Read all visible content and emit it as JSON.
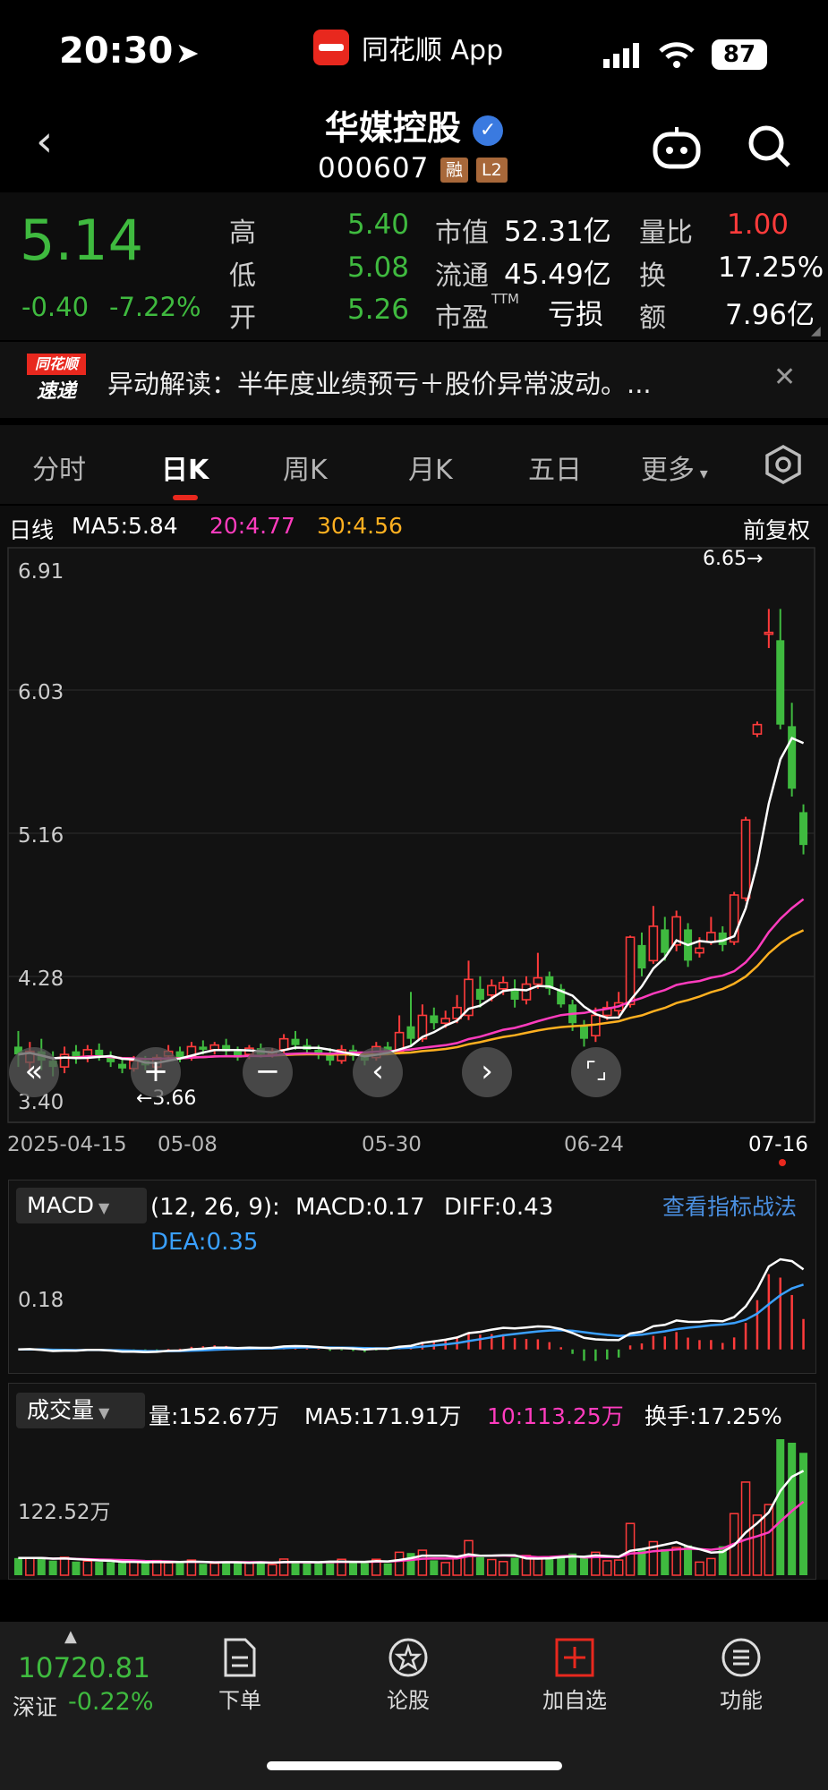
{
  "status_bar": {
    "time": "20:30",
    "app_name": "同花顺 App",
    "battery": "87"
  },
  "header": {
    "name": "华媒控股",
    "code": "000607",
    "tag_margin": "融",
    "tag_level": "L2"
  },
  "quote": {
    "price": "5.14",
    "change": "-0.40",
    "change_pct": "-7.22%",
    "high_label": "高",
    "high": "5.40",
    "low_label": "低",
    "low": "5.08",
    "open_label": "开",
    "open": "5.26",
    "mktcap_label": "市值",
    "mktcap": "52.31亿",
    "float_label": "流通",
    "float_cap": "45.49亿",
    "pe_label": "市盈",
    "pe_sup": "TTM",
    "pe": "亏损",
    "vol_ratio_label": "量比",
    "vol_ratio": "1.00",
    "turnover_label": "换",
    "turnover": "17.25%",
    "amount_label": "额",
    "amount": "7.96亿"
  },
  "news": {
    "badge_top": "同花顺",
    "badge_bottom": "速递",
    "text": "异动解读：半年度业绩预亏＋股价异常波动。..."
  },
  "tabs": [
    "分时",
    "日K",
    "周K",
    "月K",
    "五日",
    "更多"
  ],
  "active_tab": "日K",
  "kline": {
    "period_label": "日线",
    "ma5": "MA5:5.84",
    "ma20": "20:4.77",
    "ma30": "30:4.56",
    "adjust": "前复权",
    "y_labels": [
      "6.91",
      "6.03",
      "5.16",
      "4.28",
      "3.40"
    ],
    "high_mark": "6.65→",
    "low_mark": "←3.66",
    "dates": [
      "2025-04-15",
      "05-08",
      "05-30",
      "06-24",
      "07-16"
    ]
  },
  "macd": {
    "name": "MACD",
    "params": "(12, 26, 9):",
    "macd": "MACD:0.17",
    "diff": "DIFF:0.43",
    "dea": "DEA:0.35",
    "link": "查看指标战法",
    "y_label": "0.18"
  },
  "volume": {
    "name": "成交量",
    "vol": "量:152.67万",
    "ma5": "MA5:171.91万",
    "ma10": "10:113.25万",
    "turnover": "换手:17.25%",
    "y_label": "122.52万"
  },
  "index": {
    "value": "10720.81",
    "name": "深证",
    "change": "-0.22%"
  },
  "bottom_nav": [
    "下单",
    "论股",
    "加自选",
    "功能"
  ],
  "colors": {
    "up": "#ff3b3b",
    "down": "#3fba3f",
    "ma5": "#ffffff",
    "ma20": "#ff3cbe",
    "ma30": "#ffb020",
    "dea": "#3aa0ff",
    "link": "#4a8fe0"
  },
  "chart_data": {
    "type": "candlestick",
    "y_range": [
      3.4,
      6.91
    ],
    "candles": [
      {
        "o": 3.85,
        "c": 3.8,
        "h": 3.95,
        "l": 3.72
      },
      {
        "o": 3.75,
        "c": 3.82,
        "h": 3.88,
        "l": 3.7
      },
      {
        "o": 3.82,
        "c": 3.76,
        "h": 3.9,
        "l": 3.7
      },
      {
        "o": 3.76,
        "c": 3.72,
        "h": 3.82,
        "l": 3.66
      },
      {
        "o": 3.72,
        "c": 3.8,
        "h": 3.85,
        "l": 3.68
      },
      {
        "o": 3.82,
        "c": 3.78,
        "h": 3.86,
        "l": 3.74
      },
      {
        "o": 3.78,
        "c": 3.83,
        "h": 3.86,
        "l": 3.75
      },
      {
        "o": 3.83,
        "c": 3.79,
        "h": 3.87,
        "l": 3.76
      },
      {
        "o": 3.79,
        "c": 3.75,
        "h": 3.82,
        "l": 3.72
      },
      {
        "o": 3.74,
        "c": 3.71,
        "h": 3.78,
        "l": 3.68
      },
      {
        "o": 3.71,
        "c": 3.76,
        "h": 3.79,
        "l": 3.69
      },
      {
        "o": 3.76,
        "c": 3.73,
        "h": 3.79,
        "l": 3.7
      },
      {
        "o": 3.72,
        "c": 3.78,
        "h": 3.8,
        "l": 3.7
      },
      {
        "o": 3.79,
        "c": 3.82,
        "h": 3.86,
        "l": 3.76
      },
      {
        "o": 3.82,
        "c": 3.78,
        "h": 3.85,
        "l": 3.75
      },
      {
        "o": 3.79,
        "c": 3.85,
        "h": 3.88,
        "l": 3.76
      },
      {
        "o": 3.85,
        "c": 3.83,
        "h": 3.89,
        "l": 3.8
      },
      {
        "o": 3.83,
        "c": 3.86,
        "h": 3.88,
        "l": 3.8
      },
      {
        "o": 3.86,
        "c": 3.82,
        "h": 3.9,
        "l": 3.79
      },
      {
        "o": 3.82,
        "c": 3.78,
        "h": 3.85,
        "l": 3.76
      },
      {
        "o": 3.8,
        "c": 3.84,
        "h": 3.86,
        "l": 3.77
      },
      {
        "o": 3.84,
        "c": 3.8,
        "h": 3.87,
        "l": 3.78
      },
      {
        "o": 3.8,
        "c": 3.82,
        "h": 3.84,
        "l": 3.78
      },
      {
        "o": 3.83,
        "c": 3.9,
        "h": 3.93,
        "l": 3.8
      },
      {
        "o": 3.9,
        "c": 3.86,
        "h": 3.95,
        "l": 3.83
      },
      {
        "o": 3.86,
        "c": 3.83,
        "h": 3.9,
        "l": 3.8
      },
      {
        "o": 3.83,
        "c": 3.8,
        "h": 3.86,
        "l": 3.77
      },
      {
        "o": 3.8,
        "c": 3.76,
        "h": 3.84,
        "l": 3.73
      },
      {
        "o": 3.76,
        "c": 3.83,
        "h": 3.86,
        "l": 3.74
      },
      {
        "o": 3.83,
        "c": 3.79,
        "h": 3.86,
        "l": 3.76
      },
      {
        "o": 3.79,
        "c": 3.76,
        "h": 3.82,
        "l": 3.73
      },
      {
        "o": 3.78,
        "c": 3.85,
        "h": 3.88,
        "l": 3.76
      },
      {
        "o": 3.85,
        "c": 3.82,
        "h": 3.88,
        "l": 3.8
      },
      {
        "o": 3.82,
        "c": 3.94,
        "h": 4.05,
        "l": 3.8
      },
      {
        "o": 3.98,
        "c": 3.9,
        "h": 4.2,
        "l": 3.86
      },
      {
        "o": 3.9,
        "c": 4.05,
        "h": 4.12,
        "l": 3.88
      },
      {
        "o": 4.05,
        "c": 4.0,
        "h": 4.1,
        "l": 3.96
      },
      {
        "o": 4.0,
        "c": 4.03,
        "h": 4.08,
        "l": 3.97
      },
      {
        "o": 4.03,
        "c": 4.1,
        "h": 4.18,
        "l": 4.0
      },
      {
        "o": 4.05,
        "c": 4.28,
        "h": 4.4,
        "l": 4.02
      },
      {
        "o": 4.22,
        "c": 4.15,
        "h": 4.3,
        "l": 4.1
      },
      {
        "o": 4.18,
        "c": 4.24,
        "h": 4.28,
        "l": 4.14
      },
      {
        "o": 4.22,
        "c": 4.26,
        "h": 4.3,
        "l": 4.18
      },
      {
        "o": 4.22,
        "c": 4.15,
        "h": 4.28,
        "l": 4.1
      },
      {
        "o": 4.15,
        "c": 4.25,
        "h": 4.3,
        "l": 4.12
      },
      {
        "o": 4.25,
        "c": 4.29,
        "h": 4.45,
        "l": 4.22
      },
      {
        "o": 4.3,
        "c": 4.22,
        "h": 4.33,
        "l": 4.18
      },
      {
        "o": 4.22,
        "c": 4.12,
        "h": 4.25,
        "l": 4.1
      },
      {
        "o": 4.12,
        "c": 4.0,
        "h": 4.15,
        "l": 3.95
      },
      {
        "o": 3.98,
        "c": 3.9,
        "h": 4.02,
        "l": 3.85
      },
      {
        "o": 3.92,
        "c": 4.05,
        "h": 4.1,
        "l": 3.88
      },
      {
        "o": 4.05,
        "c": 4.1,
        "h": 4.14,
        "l": 4.02
      },
      {
        "o": 4.08,
        "c": 4.13,
        "h": 4.2,
        "l": 4.05
      },
      {
        "o": 4.12,
        "c": 4.55,
        "h": 4.56,
        "l": 4.1
      },
      {
        "o": 4.5,
        "c": 4.35,
        "h": 4.58,
        "l": 4.3
      },
      {
        "o": 4.4,
        "c": 4.62,
        "h": 4.75,
        "l": 4.38
      },
      {
        "o": 4.6,
        "c": 4.45,
        "h": 4.68,
        "l": 4.4
      },
      {
        "o": 4.5,
        "c": 4.68,
        "h": 4.72,
        "l": 4.46
      },
      {
        "o": 4.6,
        "c": 4.4,
        "h": 4.64,
        "l": 4.36
      },
      {
        "o": 4.45,
        "c": 4.48,
        "h": 4.55,
        "l": 4.42
      },
      {
        "o": 4.52,
        "c": 4.58,
        "h": 4.68,
        "l": 4.5
      },
      {
        "o": 4.58,
        "c": 4.5,
        "h": 4.62,
        "l": 4.46
      },
      {
        "o": 4.52,
        "c": 4.82,
        "h": 4.84,
        "l": 4.5
      },
      {
        "o": 4.8,
        "c": 5.3,
        "h": 5.32,
        "l": 4.78
      },
      {
        "o": 5.85,
        "c": 5.91,
        "h": 5.93,
        "l": 5.83
      },
      {
        "o": 6.5,
        "c": 6.5,
        "h": 6.65,
        "l": 6.4
      },
      {
        "o": 6.45,
        "c": 5.91,
        "h": 6.65,
        "l": 5.88
      },
      {
        "o": 5.9,
        "c": 5.5,
        "h": 6.05,
        "l": 5.45
      },
      {
        "o": 5.35,
        "c": 5.14,
        "h": 5.4,
        "l": 5.08
      }
    ]
  }
}
